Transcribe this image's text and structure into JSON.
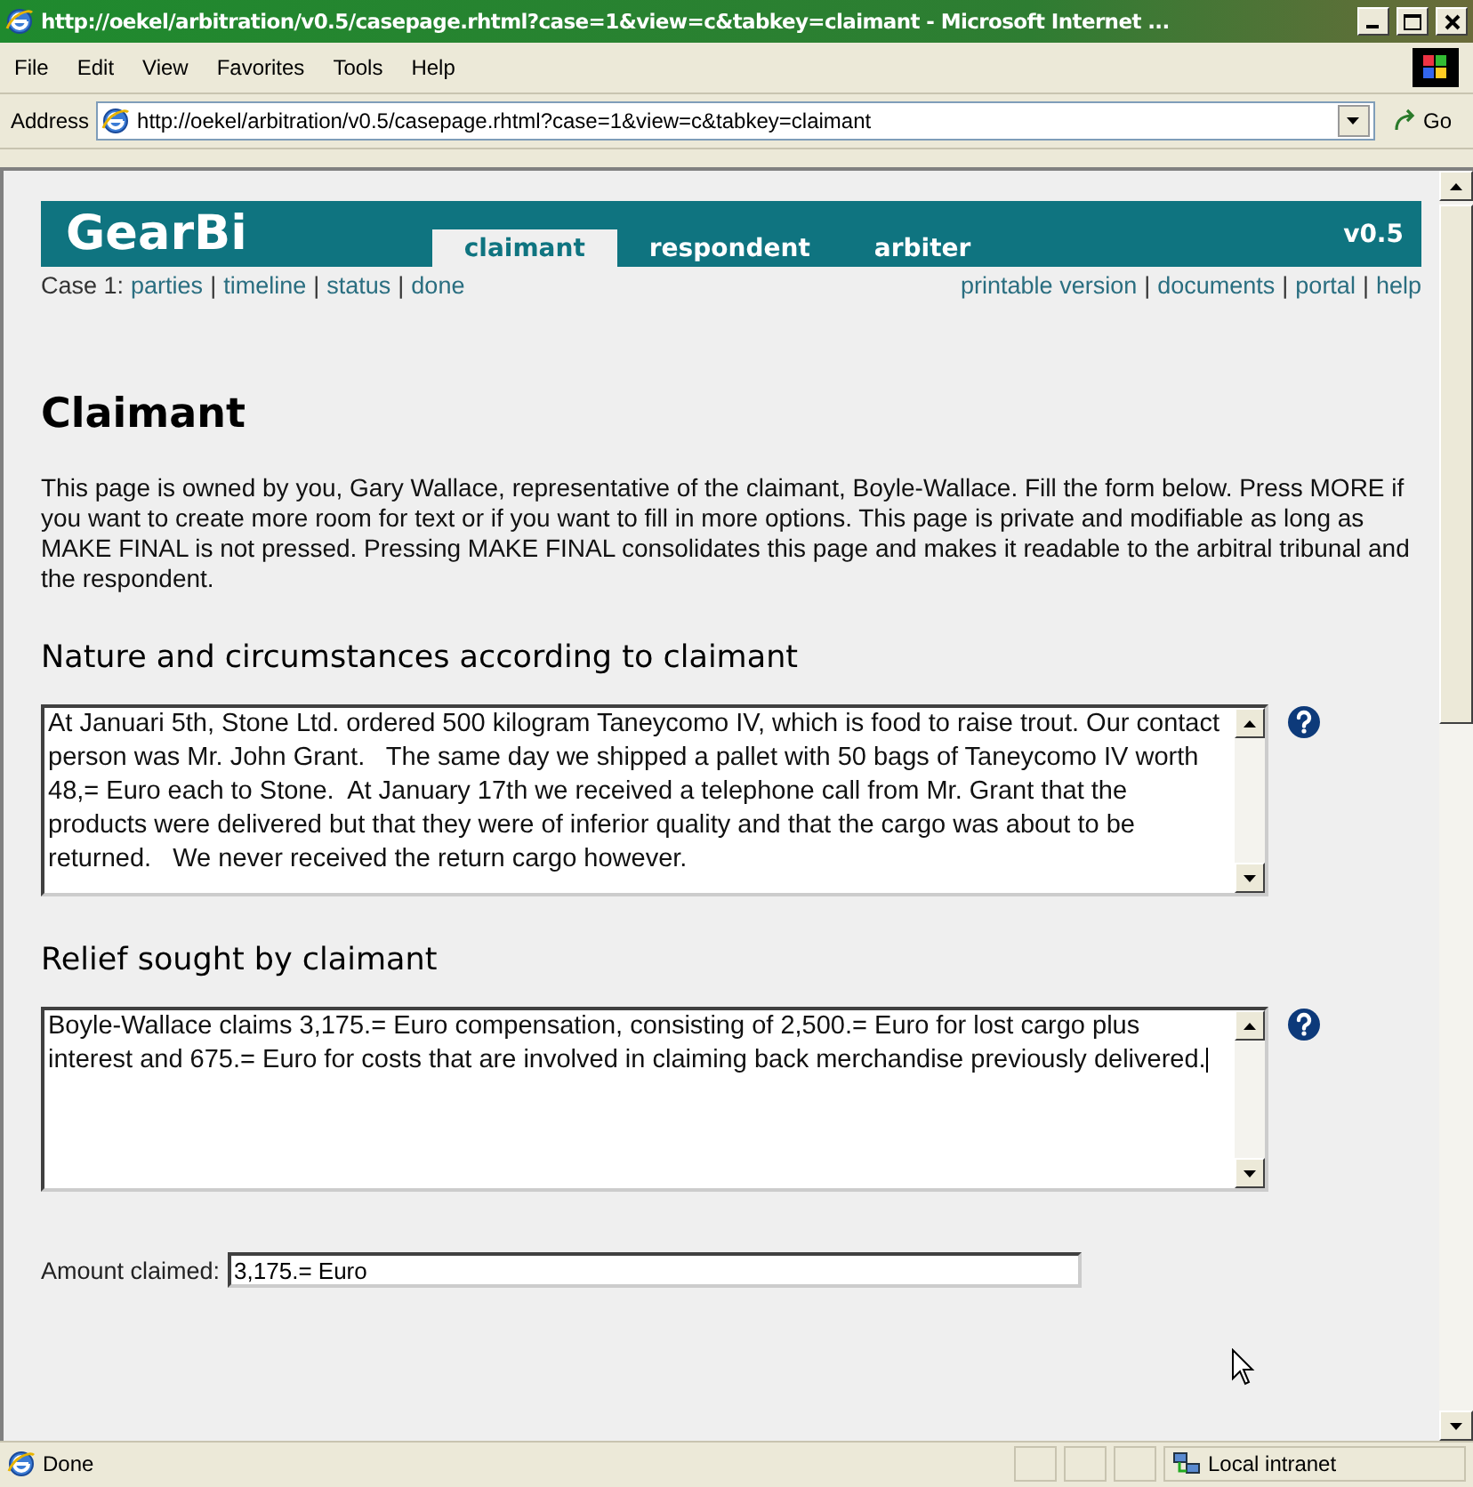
{
  "window": {
    "title": "http://oekel/arbitration/v0.5/casepage.rhtml?case=1&view=c&tabkey=claimant - Microsoft Internet ..."
  },
  "menu": [
    "File",
    "Edit",
    "View",
    "Favorites",
    "Tools",
    "Help"
  ],
  "address_bar": {
    "label": "Address",
    "url": "http://oekel/arbitration/v0.5/casepage.rhtml?case=1&view=c&tabkey=claimant",
    "go": "Go"
  },
  "page": {
    "banner": {
      "logo": "GearBi",
      "version": "v0.5",
      "tabs": [
        {
          "label": "claimant",
          "selected": true
        },
        {
          "label": "respondent",
          "selected": false
        },
        {
          "label": "arbiter",
          "selected": false
        }
      ]
    },
    "nav_left": [
      {
        "kind": "text",
        "label": "Case 1:"
      },
      {
        "kind": "link",
        "label": "parties"
      },
      {
        "kind": "sep",
        "label": "|"
      },
      {
        "kind": "link",
        "label": "timeline"
      },
      {
        "kind": "sep",
        "label": "|"
      },
      {
        "kind": "link",
        "label": "status"
      },
      {
        "kind": "sep",
        "label": "|"
      },
      {
        "kind": "link",
        "label": "done"
      }
    ],
    "nav_right": [
      {
        "kind": "link",
        "label": "printable version"
      },
      {
        "kind": "sep",
        "label": "|"
      },
      {
        "kind": "link",
        "label": "documents"
      },
      {
        "kind": "sep",
        "label": "|"
      },
      {
        "kind": "link",
        "label": "portal"
      },
      {
        "kind": "sep",
        "label": "|"
      },
      {
        "kind": "link",
        "label": "help"
      }
    ],
    "heading": "Claimant",
    "intro": "This page is owned by you, Gary Wallace, representative of the claimant, Boyle-Wallace. Fill the form below. Press MORE if you want to create more room for text or if you want to fill in more options. This page is private and modifiable as long as MAKE FINAL is not pressed. Pressing MAKE FINAL consolidates this page and makes it readable to the arbitral tribunal and the respondent.",
    "sections": [
      {
        "title": "Nature and circumstances according to claimant",
        "value": "At Januari 5th, Stone Ltd. ordered 500 kilogram Taneycomo IV, which is food to raise trout. Our contact person was Mr. John Grant.   The same day we shipped a pallet with 50 bags of Taneycomo IV worth 48,= Euro each to Stone.  At January 17th we received a telephone call from Mr. Grant that the products were delivered but that they were of inferior quality and that the cargo was about to be returned.   We never received the return cargo however.",
        "focused": false
      },
      {
        "title": "Relief sought by claimant",
        "value": "Boyle-Wallace claims 3,175.= Euro compensation, consisting of 2,500.= Euro for lost cargo plus interest and 675.= Euro for costs that are involved in claiming back merchandise previously delivered.",
        "focused": true
      }
    ],
    "amount": {
      "label": "Amount claimed:",
      "value": "3,175.= Euro"
    }
  },
  "status_bar": {
    "status": "Done",
    "zone": "Local intranet"
  }
}
